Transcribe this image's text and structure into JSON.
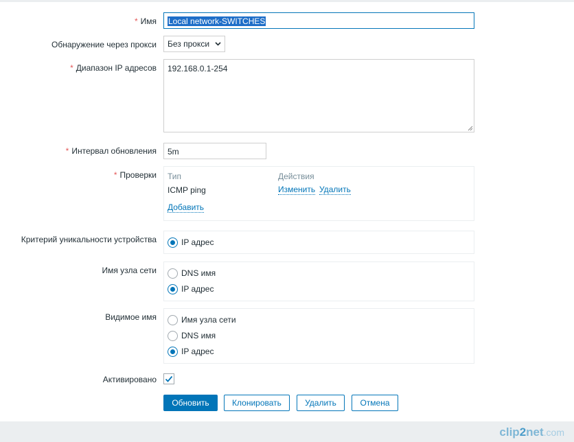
{
  "form": {
    "name": {
      "label": "Имя",
      "value": "Local network-SWITCHES"
    },
    "proxy": {
      "label": "Обнаружение через прокси",
      "value": "Без прокси"
    },
    "ip_range": {
      "label": "Диапазон IP адресов",
      "value": "192.168.0.1-254"
    },
    "interval": {
      "label": "Интервал обновления",
      "value": "5m"
    },
    "checks": {
      "label": "Проверки",
      "col_type": "Тип",
      "col_actions": "Действия",
      "rows": [
        {
          "type": "ICMP ping",
          "edit": "Изменить",
          "remove": "Удалить"
        }
      ],
      "add": "Добавить"
    },
    "uniqueness": {
      "label": "Критерий уникальности устройства",
      "options": [
        "IP адрес"
      ],
      "selected": 0
    },
    "host_name": {
      "label": "Имя узла сети",
      "options": [
        "DNS имя",
        "IP адрес"
      ],
      "selected": 1
    },
    "visible_name": {
      "label": "Видимое имя",
      "options": [
        "Имя узла сети",
        "DNS имя",
        "IP адрес"
      ],
      "selected": 2
    },
    "enabled": {
      "label": "Активировано",
      "checked": true
    }
  },
  "buttons": {
    "update": "Обновить",
    "clone": "Клонировать",
    "delete": "Удалить",
    "cancel": "Отмена"
  },
  "required_mark": "*",
  "watermark": {
    "part1": "clip",
    "part2": "2",
    "part3": "net",
    "part4": ".com"
  },
  "colors": {
    "accent": "#0275b8",
    "required": "#e45959",
    "muted": "#768d99",
    "selection": "#1e6ec8"
  }
}
